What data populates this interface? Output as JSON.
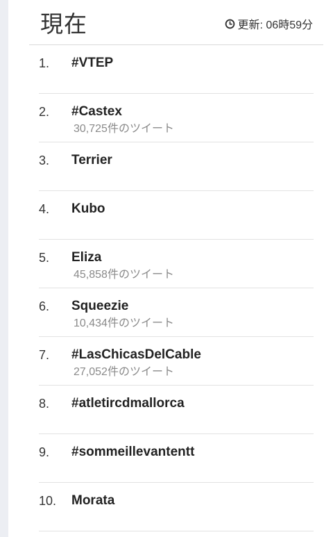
{
  "header": {
    "title": "現在",
    "updated_label": "更新: 06時59分",
    "updated_icon": "clock-icon"
  },
  "trends": [
    {
      "rank": "1.",
      "name": "#VTEP",
      "count": ""
    },
    {
      "rank": "2.",
      "name": "#Castex",
      "count": "30,725件のツイート"
    },
    {
      "rank": "3.",
      "name": "Terrier",
      "count": ""
    },
    {
      "rank": "4.",
      "name": "Kubo",
      "count": ""
    },
    {
      "rank": "5.",
      "name": "Eliza",
      "count": "45,858件のツイート"
    },
    {
      "rank": "6.",
      "name": "Squeezie",
      "count": "10,434件のツイート"
    },
    {
      "rank": "7.",
      "name": "#LasChicasDelCable",
      "count": "27,052件のツイート"
    },
    {
      "rank": "8.",
      "name": "#atletircdmallorca",
      "count": ""
    },
    {
      "rank": "9.",
      "name": "#sommeillevantentt",
      "count": ""
    },
    {
      "rank": "10.",
      "name": "Morata",
      "count": ""
    }
  ]
}
